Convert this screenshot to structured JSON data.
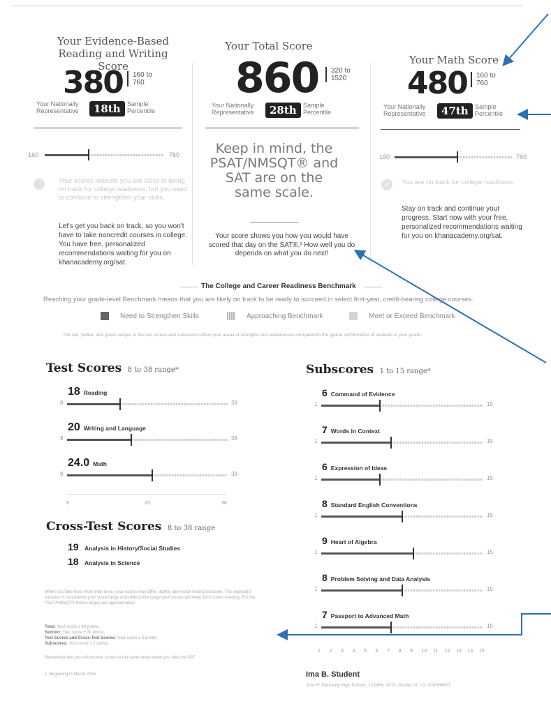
{
  "ebrw": {
    "title": "Your Evidence-Based Reading and Writing Score",
    "score": "380",
    "range": "160 to 760",
    "pct_label_left": "Your Nationally Representative",
    "percentile": "18th",
    "pct_label_right": "Sample Percentile",
    "scale_min": "160",
    "scale_max": "760",
    "marker_fraction": 0.37,
    "message": "Your scores indicate you are close to being on track for college readiness, but you need to continue to strengthen your skills.",
    "advice": "Let's get you back on track, so you won't have to take noncredit courses in college. You have free, personalized recommendations waiting for you on khanacademy.org/sat."
  },
  "total": {
    "title": "Your Total Score",
    "score": "860",
    "range": "320 to 1520",
    "pct_label_left": "Your Nationally Representative",
    "percentile": "28th",
    "pct_label_right": "Sample Percentile",
    "keep_in_mind": "Keep in mind, the PSAT/NMSQT® and SAT are on the same scale.",
    "note": "Your score shows you how you would have scored that day on the SAT®.¹ How well you do depends on what you do next!"
  },
  "math": {
    "title": "Your Math Score",
    "score": "480",
    "range": "160 to 760",
    "pct_label_left": "Your Nationally Representative",
    "percentile": "47th",
    "pct_label_right": "Sample Percentile",
    "scale_min": "160",
    "scale_max": "760",
    "marker_fraction": 0.53,
    "message": "You are on track for college readiness.",
    "advice": "Stay on track and continue your progress. Start now with your free, personalized recommendations waiting for you on khanacademy.org/sat."
  },
  "benchmark": {
    "title": "The College and Career Readiness Benchmark",
    "subtitle": "Reaching your grade-level Benchmark means that you are likely on track to be ready to succeed in select first-year, credit-bearing college courses.",
    "legend": [
      "Need to Strengthen Skills",
      "Approaching Benchmark",
      "Meet or Exceed Benchmark"
    ],
    "footnote": "The red, yellow, and green ranges in the test scores and subscores reflect your areas of strengths and weaknesses compared to the typical performance of students in your grade."
  },
  "test_scores": {
    "title": "Test Scores",
    "range": "8 to 38 range*",
    "min": "8",
    "max": "38",
    "items": [
      {
        "score": "18",
        "label": "Reading",
        "fraction": 0.33
      },
      {
        "score": "20",
        "label": "Writing and Language",
        "fraction": 0.4
      },
      {
        "score": "24.0",
        "label": "Math",
        "fraction": 0.53
      }
    ],
    "axis": [
      "8",
      "23",
      "38"
    ]
  },
  "cross_test": {
    "title": "Cross-Test Scores",
    "range": "8 to 38 range",
    "items": [
      {
        "score": "19",
        "label": "Analysis in History/Social Studies"
      },
      {
        "score": "18",
        "label": "Analysis in Science"
      }
    ]
  },
  "subscores": {
    "title": "Subscores",
    "range": "1 to 15 range*",
    "min": "1",
    "max": "15",
    "items": [
      {
        "score": "6",
        "label": "Command of Evidence",
        "fraction": 0.36
      },
      {
        "score": "7",
        "label": "Words in Context",
        "fraction": 0.43
      },
      {
        "score": "6",
        "label": "Expression of Ideas",
        "fraction": 0.36
      },
      {
        "score": "8",
        "label": "Standard English Conventions",
        "fraction": 0.5
      },
      {
        "score": "9",
        "label": "Heart of Algebra",
        "fraction": 0.57
      },
      {
        "score": "8",
        "label": "Problem Solving and Data Analysis",
        "fraction": 0.5
      },
      {
        "score": "7",
        "label": "Passport to Advanced Math",
        "fraction": 0.43
      }
    ],
    "axis": [
      "1",
      "2",
      "3",
      "4",
      "5",
      "6",
      "7",
      "8",
      "9",
      "10",
      "11",
      "12",
      "13",
      "14",
      "15"
    ]
  },
  "variation": {
    "para": "When you take tests more than once, your scores may differ slightly upon each testing occasion. This expected variation is considered your score range and reflects the range your scores will likely fall in upon retesting. For the PSAT/NMSQT® these ranges are approximately:",
    "total": "Your score ± 40 points.",
    "section": "Your score ± 30 points.",
    "test": "Your score ± 3 points.",
    "sub": "Your score ± 2 points.",
    "total_lbl": "Total:",
    "section_lbl": "Section:",
    "test_lbl": "Test Scores and Cross-Test Scores:",
    "sub_lbl": "Subscores:",
    "remember": "Remember that you will receive scores in the same areas when you take the SAT.",
    "footnote": "1. Beginning in March 2016"
  },
  "student": {
    "name": "Ima B. Student",
    "info": "John F. Kennedy High School, 123456, 2015, Grade 10, I.D. #24066807"
  },
  "colors": {
    "dark": "#555555",
    "ghost": "#d0d0d0",
    "arrow": "#2e6fb5"
  }
}
